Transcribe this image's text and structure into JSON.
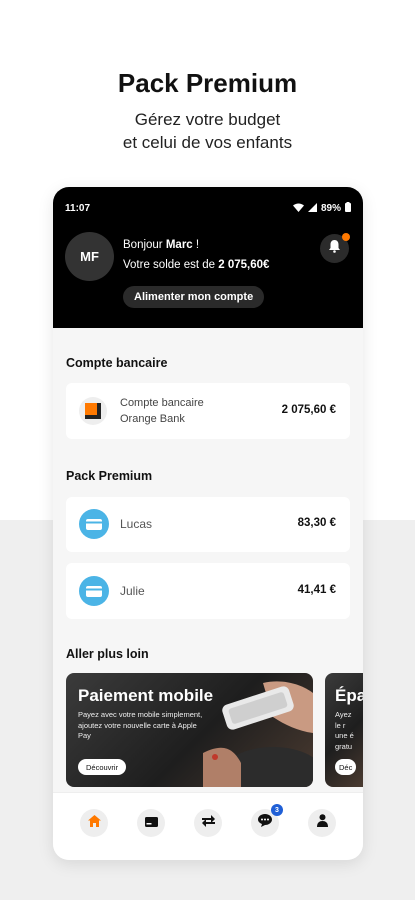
{
  "promo": {
    "title": "Pack Premium",
    "subtitle_line1": "Gérez votre budget",
    "subtitle_line2": "et celui de vos enfants"
  },
  "status_bar": {
    "time": "11:07",
    "battery": "89%"
  },
  "header": {
    "avatar_initials": "MF",
    "greeting_prefix": "Bonjour ",
    "user_name": "Marc",
    "greeting_suffix": " !",
    "balance_prefix": "Votre solde est de ",
    "balance_amount": "2 075,60€",
    "topup_label": "Alimenter mon compte",
    "notification_accent": "#ff7900"
  },
  "bank_section": {
    "title": "Compte bancaire",
    "account": {
      "label_line1": "Compte bancaire",
      "label_line2": "Orange Bank",
      "amount": "2 075,60 €",
      "icon": "orange-bank-logo"
    }
  },
  "premium_section": {
    "title": "Pack Premium",
    "kids": [
      {
        "name": "Lucas",
        "amount": "83,30 €",
        "icon": "card-icon"
      },
      {
        "name": "Julie",
        "amount": "41,41 €",
        "icon": "card-icon"
      }
    ],
    "accent": "#4bb4e6"
  },
  "more_section": {
    "title": "Aller plus loin",
    "cards": [
      {
        "title": "Paiement mobile",
        "description": "Payez avec votre mobile simplement, ajoutez votre nouvelle carte à Apple Pay",
        "button": "Découvrir"
      },
      {
        "title": "Épa",
        "description": "Ayez le r une é gratu",
        "button": "Déc"
      }
    ]
  },
  "bottom_nav": {
    "items": [
      "home-icon",
      "card-icon",
      "transfer-icon",
      "chat-icon",
      "profile-icon"
    ],
    "chat_badge": "3",
    "active_color": "#ff7900"
  }
}
